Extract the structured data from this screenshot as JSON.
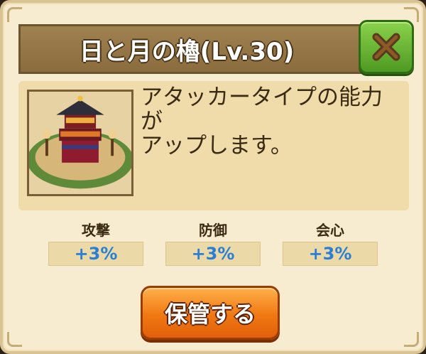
{
  "dialog": {
    "title": "日と月の櫓(Lv.30)",
    "close_icon": "close-x-icon",
    "item_image": "tower-building-image",
    "description": "アタッカータイプの能力\nが\nアップします。"
  },
  "stats": [
    {
      "label": "攻撃",
      "value": "+3%"
    },
    {
      "label": "防御",
      "value": "+3%"
    },
    {
      "label": "会心",
      "value": "+3%"
    }
  ],
  "actions": {
    "store_label": "保管する"
  },
  "colors": {
    "accent_orange": "#f07812",
    "close_green": "#5aa82a",
    "stat_blue": "#2a7fd4",
    "title_bar": "#947444"
  }
}
